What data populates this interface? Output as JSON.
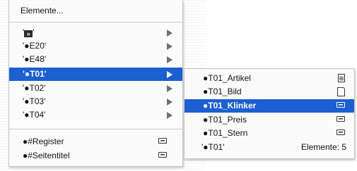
{
  "main_menu": {
    "header": "Elemente...",
    "items": [
      {
        "label": "'●E20'"
      },
      {
        "label": "'●E48'"
      },
      {
        "label": "'●T01'"
      },
      {
        "label": "'●T02'"
      },
      {
        "label": "'●T03'"
      },
      {
        "label": "'●T04'"
      }
    ],
    "top_item": {
      "prefix": "'",
      "suffix": "'"
    },
    "bottom_items": [
      {
        "label": "●#Register"
      },
      {
        "label": "●#Seitentitel"
      }
    ]
  },
  "sub_menu": {
    "items": [
      {
        "label": "●T01_Artikel",
        "icon": "text-icon"
      },
      {
        "label": "●T01_Bild",
        "icon": "page-icon"
      },
      {
        "label": "●T01_Klinker",
        "icon": "field-icon"
      },
      {
        "label": "●T01_Preis",
        "icon": "field-icon"
      },
      {
        "label": "●T01_Stern",
        "icon": "field-icon"
      }
    ],
    "footer": {
      "label": "'●T01'",
      "count": "Elemente: 5"
    }
  },
  "colors": {
    "selection": "#1b5fd1",
    "arrow": "#707070"
  }
}
